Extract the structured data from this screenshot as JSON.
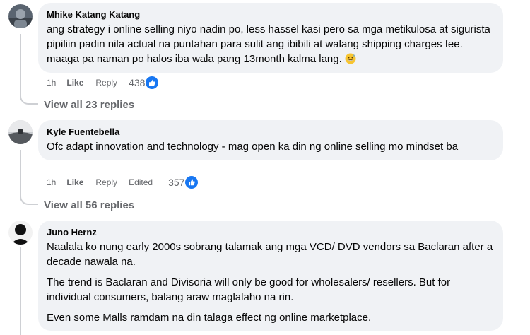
{
  "comments": [
    {
      "author": "Mhike Katang Katang",
      "paragraphs": [
        "ang strategy i online selling niyo nadin po, less hassel kasi pero sa mga metikulosa at sigurista pipiliin padin nila actual na puntahan para sulit ang ibibili at walang shipping charges fee. maaga pa naman po halos iba wala pang 13month kalma lang."
      ],
      "time": "1h",
      "like_label": "Like",
      "reply_label": "Reply",
      "reactions": "438",
      "view_replies": "View all 23 replies",
      "emoji": "grinning-sweat-emoji"
    },
    {
      "author": "Kyle Fuentebella",
      "paragraphs": [
        "Ofc adapt innovation and technology - mag open ka din ng online selling mo mindset ba"
      ],
      "time": "1h",
      "like_label": "Like",
      "reply_label": "Reply",
      "edited_label": "Edited",
      "reactions": "357",
      "view_replies": "View all 56 replies"
    },
    {
      "author": "Juno Hernz",
      "paragraphs": [
        "Naalala ko nung early 2000s sobrang talamak ang mga VCD/ DVD vendors sa Baclaran after a decade nawala na.",
        "The trend is Baclaran and Divisoria will only be good for wholesalers/ resellers. But for individual consumers, balang araw maglalaho na rin.",
        "Even some Malls ramdam na din talaga effect ng online marketplace."
      ]
    }
  ],
  "colors": {
    "bubble": "#f0f2f5",
    "secondary_text": "#65676b",
    "like_blue": "#1877f2"
  }
}
